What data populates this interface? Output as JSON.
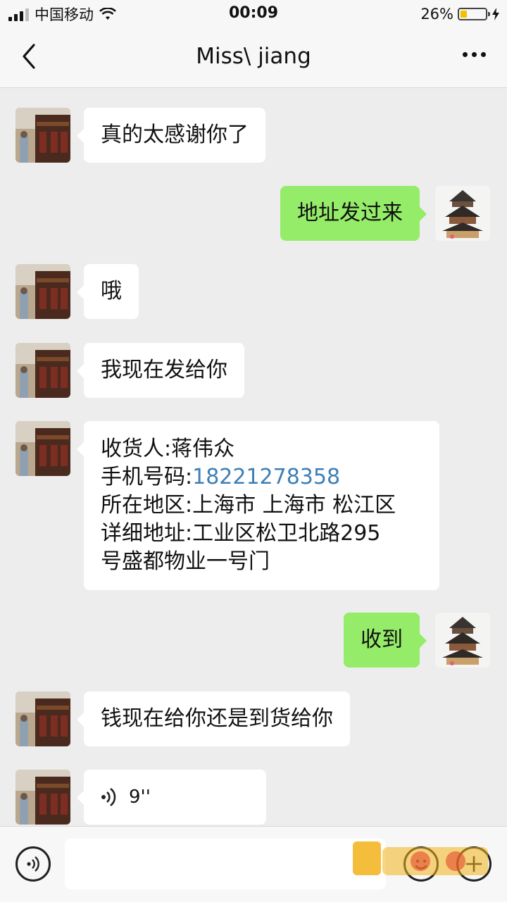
{
  "status_bar": {
    "carrier": "中国移动",
    "time": "00:09",
    "battery_percent": "26%",
    "battery_level": 0.26
  },
  "nav": {
    "title": "Miss\\ jiang"
  },
  "messages": [
    {
      "side": "in",
      "text": "真的太感谢你了"
    },
    {
      "side": "out",
      "text": "地址发过来"
    },
    {
      "side": "in",
      "text": "哦"
    },
    {
      "side": "in",
      "text": "我现在发给你"
    },
    {
      "side": "in",
      "lines": [
        "收货人:蒋伟众",
        "手机号码:",
        "所在地区:上海市 上海市 松江区",
        "详细地址:工业区松卫北路295",
        "号盛都物业一号门"
      ],
      "phone": "18221278358"
    },
    {
      "side": "out",
      "text": "收到"
    },
    {
      "side": "in",
      "text": "钱现在给你还是到货给你"
    },
    {
      "side": "in",
      "type": "voice",
      "duration": "9''"
    }
  ],
  "input": {
    "placeholder": ""
  },
  "icons": {
    "back": "chevron-left-icon",
    "more": "more-dots-icon",
    "voice_toggle": "voice-icon",
    "emoji": "emoji-icon",
    "plus": "plus-icon",
    "wifi": "wifi-icon",
    "charging": "charging-bolt-icon"
  },
  "colors": {
    "outgoing_bubble": "#95ec69",
    "incoming_bubble": "#ffffff",
    "background": "#ededed",
    "link": "#3d7fb6",
    "battery": "#f2c200"
  }
}
